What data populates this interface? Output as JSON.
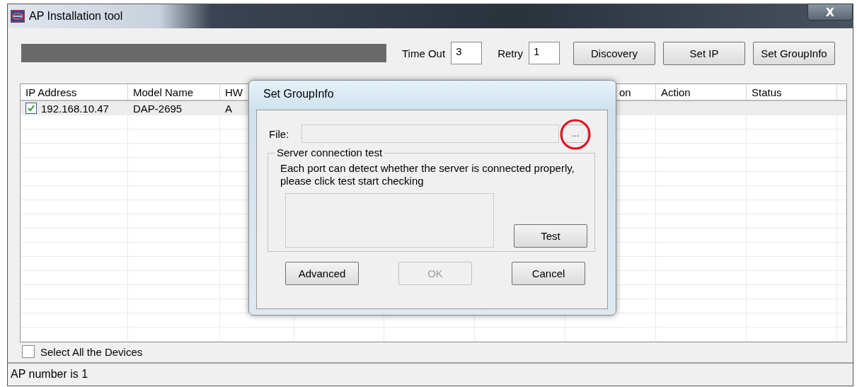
{
  "window": {
    "title": "AP Installation tool",
    "close_label": "X"
  },
  "toolbar": {
    "progress": {
      "level": 1
    },
    "timeout": {
      "label": "Time Out",
      "value": "3"
    },
    "retry": {
      "label": "Retry",
      "value": "1"
    },
    "buttons": [
      "Discovery",
      "Set IP",
      "Set GroupInfo"
    ]
  },
  "table": {
    "columns": [
      "IP Address",
      "Model Name",
      "HW",
      "",
      "",
      "",
      "on",
      "Action",
      "Status"
    ],
    "rows": [
      {
        "checked": true,
        "selected": true,
        "cells": [
          "192.168.10.47",
          "DAP-2695",
          "A"
        ]
      }
    ]
  },
  "select_all": {
    "label": "Select All the Devices",
    "checked": false
  },
  "status_bar": "AP number is 1",
  "dialog": {
    "title": "Set GroupInfo",
    "file_label": "File:",
    "browse": {
      "label": "...",
      "highlighted": true
    },
    "group_title": "Server connection test",
    "description": "Each port can detect whether the server is connected properly, please click test start checking",
    "test_button": "Test",
    "buttons": [
      {
        "label": "Advanced",
        "disabled": false
      },
      {
        "label": "OK",
        "disabled": true
      },
      {
        "label": "Cancel",
        "disabled": false
      }
    ]
  }
}
